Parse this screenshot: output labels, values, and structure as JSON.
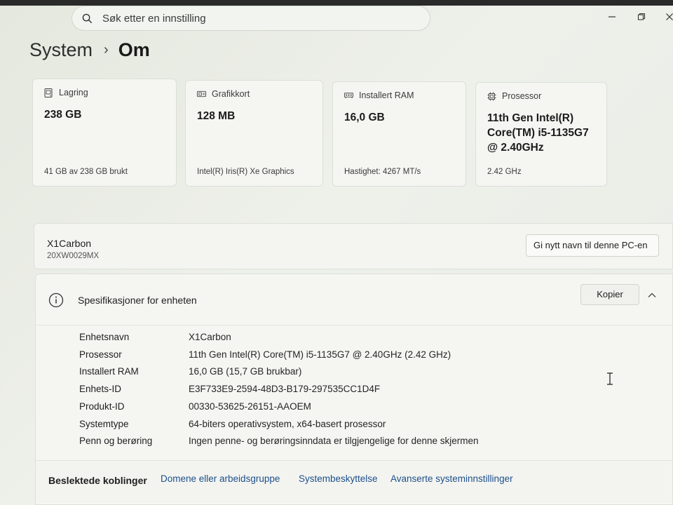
{
  "search": {
    "placeholder": "Søk etter en innstilling"
  },
  "breadcrumb": {
    "parent": "System",
    "current": "Om"
  },
  "cards": [
    {
      "title": "Lagring",
      "value": "238 GB",
      "footer": "41 GB av 238 GB brukt",
      "icon": "storage-icon"
    },
    {
      "title": "Grafikkort",
      "value": "128 MB",
      "footer": "Intel(R) Iris(R) Xe Graphics",
      "icon": "gpu-icon"
    },
    {
      "title": "Installert RAM",
      "value": "16,0 GB",
      "footer": "Hastighet: 4267 MT/s",
      "icon": "ram-icon"
    },
    {
      "title": "Prosessor",
      "value": "11th Gen Intel(R) Core(TM) i5-1135G7 @ 2.40GHz",
      "footer": "2.42 GHz",
      "icon": "cpu-icon"
    }
  ],
  "device": {
    "name": "X1Carbon",
    "model": "20XW0029MX",
    "rename_label": "Gi nytt navn til denne PC-en"
  },
  "specs": {
    "title": "Spesifikasjoner for enheten",
    "copy_label": "Kopier",
    "rows": [
      {
        "label": "Enhetsnavn",
        "value": "X1Carbon"
      },
      {
        "label": "Prosessor",
        "value": "11th Gen Intel(R) Core(TM) i5-1135G7 @ 2.40GHz (2.42 GHz)"
      },
      {
        "label": "Installert RAM",
        "value": "16,0 GB (15,7 GB brukbar)"
      },
      {
        "label": "Enhets-ID",
        "value": "E3F733E9-2594-48D3-B179-297535CC1D4F"
      },
      {
        "label": "Produkt-ID",
        "value": "00330-53625-26151-AAOEM"
      },
      {
        "label": "Systemtype",
        "value": "64-biters operativsystem, x64-basert prosessor"
      },
      {
        "label": "Penn og berøring",
        "value": "Ingen penne- og berøringsinndata er tilgjengelige for denne skjermen"
      }
    ]
  },
  "related": {
    "label": "Beslektede koblinger",
    "links": [
      "Domene eller arbeidsgruppe",
      "Systembeskyttelse",
      "Avanserte systeminnstillinger"
    ]
  },
  "colors": {
    "link": "#1d4f8a",
    "background": "#e9ece6",
    "card": "#f5f6f2"
  }
}
